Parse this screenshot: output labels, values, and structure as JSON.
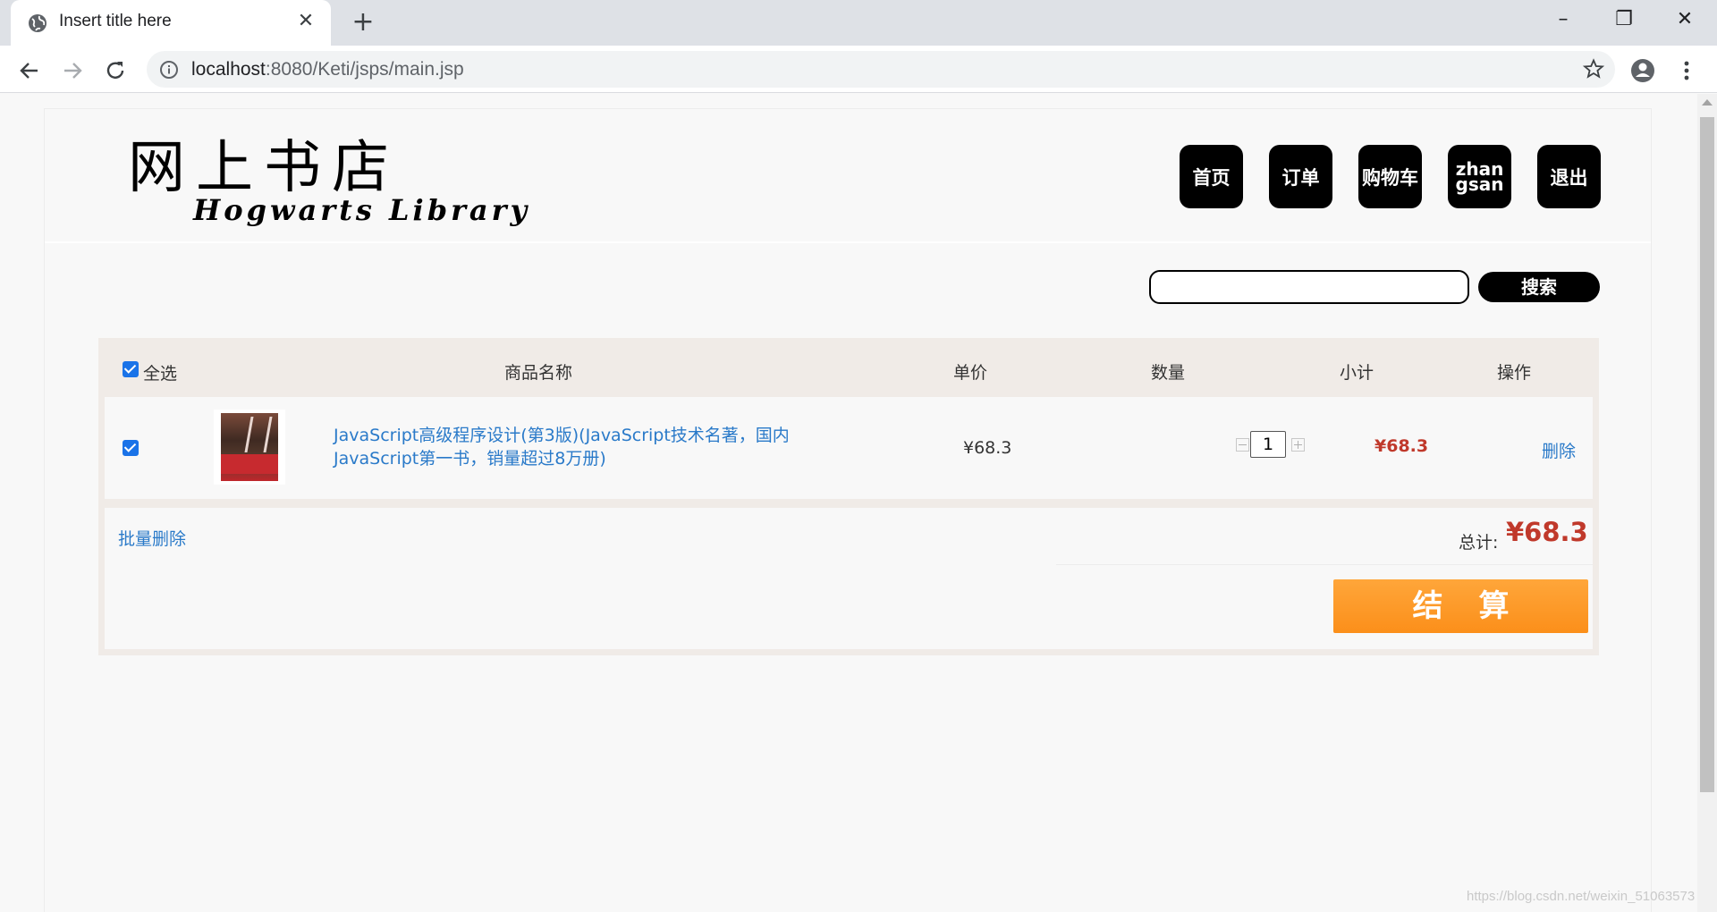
{
  "browser": {
    "tab_title": "Insert title here",
    "url_host": "localhost",
    "url_path": ":8080/Keti/jsps/main.jsp"
  },
  "header": {
    "logo_cn": "网上书店",
    "logo_en": "Hogwarts Library",
    "nav": [
      "首页",
      "订单",
      "购物车",
      "zhangsan",
      "退出"
    ]
  },
  "search": {
    "value": "",
    "button_label": "搜索"
  },
  "cart": {
    "columns": {
      "select_all": "全选",
      "name": "商品名称",
      "unit_price": "单价",
      "quantity": "数量",
      "subtotal": "小计",
      "action": "操作"
    },
    "items": [
      {
        "checked": true,
        "name": "JavaScript高级程序设计(第3版)(JavaScript技术名著，国内JavaScript第一书，销量超过8万册)",
        "price": "¥68.3",
        "quantity": "1",
        "subtotal": "¥68.3",
        "action": "删除"
      }
    ],
    "batch_delete": "批量删除",
    "total_label": "总计:",
    "total_value": "¥68.3",
    "checkout_label": "结算"
  },
  "watermark": "https://blog.csdn.net/weixin_51063573"
}
